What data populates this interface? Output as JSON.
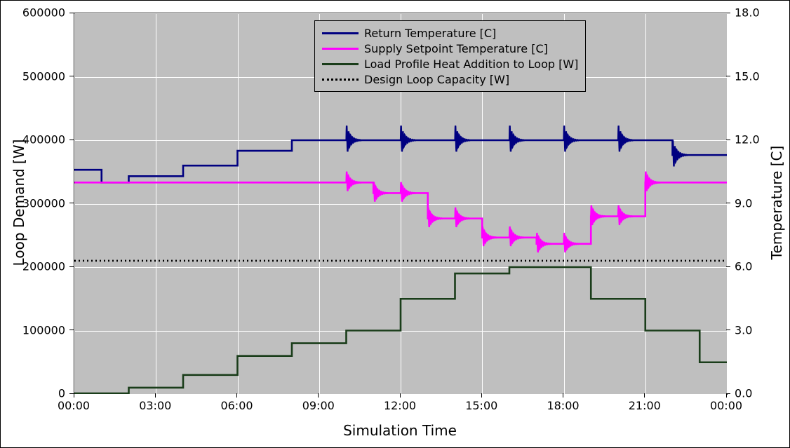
{
  "chart_data": {
    "type": "line",
    "title": "",
    "xlabel": "Simulation Time",
    "ylabel_left": "Loop Demand [W]",
    "ylabel_right": "Temperature [C]",
    "x_ticks": [
      "00:00",
      "03:00",
      "06:00",
      "09:00",
      "12:00",
      "15:00",
      "18:00",
      "21:00",
      "00:00"
    ],
    "y_left_ticks": [
      0,
      100000,
      200000,
      300000,
      400000,
      500000,
      600000
    ],
    "y_right_ticks": [
      0.0,
      3.0,
      6.0,
      9.0,
      12.0,
      15.0,
      18.0
    ],
    "y_left_range": [
      0,
      600000
    ],
    "y_right_range": [
      0.0,
      18.0
    ],
    "x_hours": [
      0,
      1,
      2,
      3,
      4,
      5,
      6,
      7,
      8,
      9,
      10,
      11,
      12,
      13,
      14,
      15,
      16,
      17,
      18,
      19,
      20,
      21,
      22,
      23,
      24
    ],
    "series": [
      {
        "name": "Return Temperature [C]",
        "axis": "right",
        "color": "#000080",
        "style": "solid",
        "values": [
          10.6,
          10.0,
          10.3,
          10.3,
          10.8,
          10.8,
          11.5,
          11.5,
          12.0,
          12.0,
          12.0,
          12.0,
          12.0,
          12.0,
          12.0,
          12.0,
          12.0,
          12.0,
          12.0,
          12.0,
          12.0,
          12.0,
          11.3,
          11.3,
          11.3
        ]
      },
      {
        "name": "Supply Setpoint Temperature [C]",
        "axis": "right",
        "color": "#ff00ff",
        "style": "solid",
        "values": [
          10.0,
          10.0,
          10.0,
          10.0,
          10.0,
          10.0,
          10.0,
          10.0,
          10.0,
          10.0,
          10.0,
          9.5,
          9.5,
          8.3,
          8.3,
          7.4,
          7.4,
          7.1,
          7.1,
          8.4,
          8.4,
          10.0,
          10.0,
          10.0,
          10.0
        ]
      },
      {
        "name": "Load Profile Heat Addition to Loop [W]",
        "axis": "left",
        "color": "#1a3d1a",
        "style": "solid",
        "values": [
          1000,
          1000,
          10000,
          10000,
          30000,
          30000,
          60000,
          60000,
          80000,
          80000,
          100000,
          100000,
          150000,
          150000,
          190000,
          190000,
          200000,
          200000,
          200000,
          150000,
          150000,
          100000,
          100000,
          50000,
          50000
        ]
      },
      {
        "name": "Design Loop Capacity [W]",
        "axis": "left",
        "color": "#000000",
        "style": "dotted",
        "values": [
          210000,
          210000,
          210000,
          210000,
          210000,
          210000,
          210000,
          210000,
          210000,
          210000,
          210000,
          210000,
          210000,
          210000,
          210000,
          210000,
          210000,
          210000,
          210000,
          210000,
          210000,
          210000,
          210000,
          210000,
          210000
        ]
      }
    ],
    "legend": {
      "position": "top-center",
      "entries": [
        "Return Temperature [C]",
        "Supply Setpoint Temperature [C]",
        "Load Profile Heat Addition to Loop [W]",
        "Design Loop Capacity [W]"
      ]
    },
    "oscillation_hours_return": [
      10,
      12,
      14,
      16,
      18,
      20,
      22
    ],
    "oscillation_hours_supply": [
      10,
      11,
      12,
      13,
      14,
      15,
      16,
      17,
      18,
      19,
      20,
      21
    ]
  }
}
